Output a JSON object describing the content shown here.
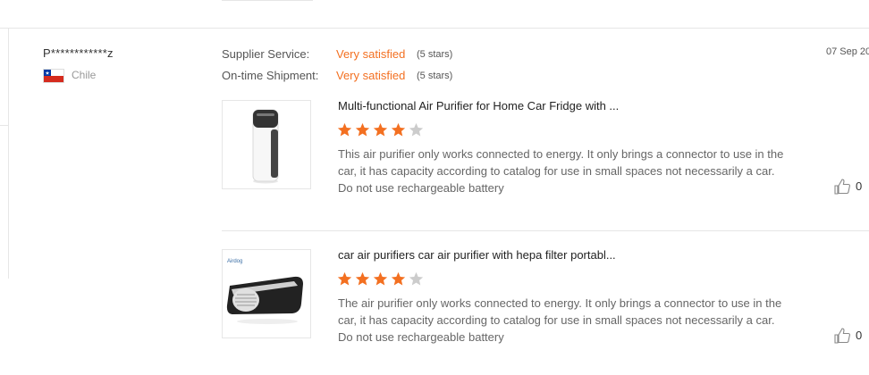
{
  "reviewer": {
    "username": "P************z",
    "country": "Chile"
  },
  "meta": {
    "supplier_service_label": "Supplier Service:",
    "supplier_service_value": "Very satisfied",
    "supplier_service_stars": "(5 stars)",
    "ontime_label": "On-time Shipment:",
    "ontime_value": "Very satisfied",
    "ontime_stars": "(5 stars)"
  },
  "date": "07 Sep 20",
  "products": [
    {
      "title": "Multi-functional Air Purifier for Home Car Fridge with ...",
      "rating": 4,
      "max_rating": 5,
      "review": "This air purifier only works connected to energy. It only brings a connector to use in the car, it has capacity according to catalog for use in small spaces not necessarily a car. Do not use rechargeable battery",
      "likes": "0"
    },
    {
      "title": "car air purifiers car air purifier with hepa filter portabl...",
      "rating": 4,
      "max_rating": 5,
      "review": "The air purifier only works connected to energy. It only brings a connector to use in the car, it has capacity according to catalog for use in small spaces not necessarily a car. Do not use rechargeable battery",
      "likes": "0"
    }
  ],
  "colors": {
    "accent": "#f37021",
    "star_empty": "#cccccc"
  }
}
